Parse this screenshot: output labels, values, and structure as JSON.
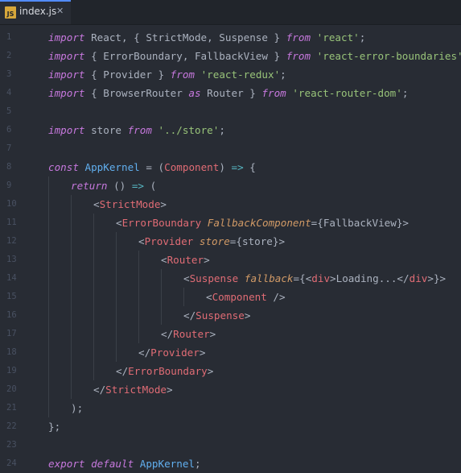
{
  "tab": {
    "icon_text": "JS",
    "filename": "index.js",
    "close_glyph": "✕"
  },
  "colors": {
    "keyword": "#c678dd",
    "string": "#98c379",
    "tag": "#e06c75",
    "attribute": "#d19a66",
    "function": "#61afef"
  },
  "lines": [
    {
      "n": "1",
      "indent": 0,
      "tokens": [
        [
          "kw",
          "import"
        ],
        [
          "plain",
          " React, { StrictMode, Suspense } "
        ],
        [
          "kw",
          "from"
        ],
        [
          "plain",
          " "
        ],
        [
          "str",
          "'react'"
        ],
        [
          "plain",
          ";"
        ]
      ]
    },
    {
      "n": "2",
      "indent": 0,
      "tokens": [
        [
          "kw",
          "import"
        ],
        [
          "plain",
          " { ErrorBoundary, FallbackView } "
        ],
        [
          "kw",
          "from"
        ],
        [
          "plain",
          " "
        ],
        [
          "str",
          "'react-error-boundaries'"
        ],
        [
          "plain",
          ";"
        ]
      ]
    },
    {
      "n": "3",
      "indent": 0,
      "tokens": [
        [
          "kw",
          "import"
        ],
        [
          "plain",
          " { Provider } "
        ],
        [
          "kw",
          "from"
        ],
        [
          "plain",
          " "
        ],
        [
          "str",
          "'react-redux'"
        ],
        [
          "plain",
          ";"
        ]
      ]
    },
    {
      "n": "4",
      "indent": 0,
      "tokens": [
        [
          "kw",
          "import"
        ],
        [
          "plain",
          " { BrowserRouter "
        ],
        [
          "kw",
          "as"
        ],
        [
          "plain",
          " Router } "
        ],
        [
          "kw",
          "from"
        ],
        [
          "plain",
          " "
        ],
        [
          "str",
          "'react-router-dom'"
        ],
        [
          "plain",
          ";"
        ]
      ]
    },
    {
      "n": "5",
      "indent": 0,
      "tokens": []
    },
    {
      "n": "6",
      "indent": 0,
      "tokens": [
        [
          "kw",
          "import"
        ],
        [
          "plain",
          " store "
        ],
        [
          "kw",
          "from"
        ],
        [
          "plain",
          " "
        ],
        [
          "str",
          "'../store'"
        ],
        [
          "plain",
          ";"
        ]
      ]
    },
    {
      "n": "7",
      "indent": 0,
      "tokens": []
    },
    {
      "n": "8",
      "indent": 0,
      "tokens": [
        [
          "kw",
          "const"
        ],
        [
          "plain",
          " "
        ],
        [
          "fn",
          "AppKernel"
        ],
        [
          "plain",
          " = ("
        ],
        [
          "param",
          "Component"
        ],
        [
          "plain",
          ") "
        ],
        [
          "kw-plain",
          "=>"
        ],
        [
          "plain",
          " {"
        ]
      ]
    },
    {
      "n": "9",
      "indent": 1,
      "tokens": [
        [
          "kw",
          "return"
        ],
        [
          "plain",
          " () "
        ],
        [
          "kw-plain",
          "=>"
        ],
        [
          "plain",
          " ("
        ]
      ]
    },
    {
      "n": "10",
      "indent": 2,
      "tokens": [
        [
          "plain",
          "<"
        ],
        [
          "tag",
          "StrictMode"
        ],
        [
          "plain",
          ">"
        ]
      ]
    },
    {
      "n": "11",
      "indent": 3,
      "tokens": [
        [
          "plain",
          "<"
        ],
        [
          "tag",
          "ErrorBoundary"
        ],
        [
          "plain",
          " "
        ],
        [
          "attr",
          "FallbackComponent"
        ],
        [
          "plain",
          "={FallbackView}>"
        ]
      ]
    },
    {
      "n": "12",
      "indent": 4,
      "tokens": [
        [
          "plain",
          "<"
        ],
        [
          "tag",
          "Provider"
        ],
        [
          "plain",
          " "
        ],
        [
          "attr",
          "store"
        ],
        [
          "plain",
          "={store}>"
        ]
      ]
    },
    {
      "n": "13",
      "indent": 5,
      "tokens": [
        [
          "plain",
          "<"
        ],
        [
          "tag",
          "Router"
        ],
        [
          "plain",
          ">"
        ]
      ]
    },
    {
      "n": "14",
      "indent": 6,
      "tokens": [
        [
          "plain",
          "<"
        ],
        [
          "tag",
          "Suspense"
        ],
        [
          "plain",
          " "
        ],
        [
          "attr",
          "fallback"
        ],
        [
          "plain",
          "={<"
        ],
        [
          "tag",
          "div"
        ],
        [
          "plain",
          ">Loading...</"
        ],
        [
          "tag",
          "div"
        ],
        [
          "plain",
          ">}>"
        ]
      ]
    },
    {
      "n": "15",
      "indent": 7,
      "tokens": [
        [
          "plain",
          "<"
        ],
        [
          "tag",
          "Component"
        ],
        [
          "plain",
          " />"
        ]
      ]
    },
    {
      "n": "16",
      "indent": 6,
      "tokens": [
        [
          "plain",
          "</"
        ],
        [
          "tag",
          "Suspense"
        ],
        [
          "plain",
          ">"
        ]
      ]
    },
    {
      "n": "17",
      "indent": 5,
      "tokens": [
        [
          "plain",
          "</"
        ],
        [
          "tag",
          "Router"
        ],
        [
          "plain",
          ">"
        ]
      ]
    },
    {
      "n": "18",
      "indent": 4,
      "tokens": [
        [
          "plain",
          "</"
        ],
        [
          "tag",
          "Provider"
        ],
        [
          "plain",
          ">"
        ]
      ]
    },
    {
      "n": "19",
      "indent": 3,
      "tokens": [
        [
          "plain",
          "</"
        ],
        [
          "tag",
          "ErrorBoundary"
        ],
        [
          "plain",
          ">"
        ]
      ]
    },
    {
      "n": "20",
      "indent": 2,
      "tokens": [
        [
          "plain",
          "</"
        ],
        [
          "tag",
          "StrictMode"
        ],
        [
          "plain",
          ">"
        ]
      ]
    },
    {
      "n": "21",
      "indent": 1,
      "tokens": [
        [
          "plain",
          ");"
        ]
      ]
    },
    {
      "n": "22",
      "indent": 0,
      "tokens": [
        [
          "plain",
          "};"
        ]
      ]
    },
    {
      "n": "23",
      "indent": 0,
      "tokens": []
    },
    {
      "n": "24",
      "indent": 0,
      "tokens": [
        [
          "kw",
          "export"
        ],
        [
          "plain",
          " "
        ],
        [
          "kw",
          "default"
        ],
        [
          "plain",
          " "
        ],
        [
          "fn",
          "AppKernel"
        ],
        [
          "plain",
          ";"
        ]
      ]
    }
  ]
}
